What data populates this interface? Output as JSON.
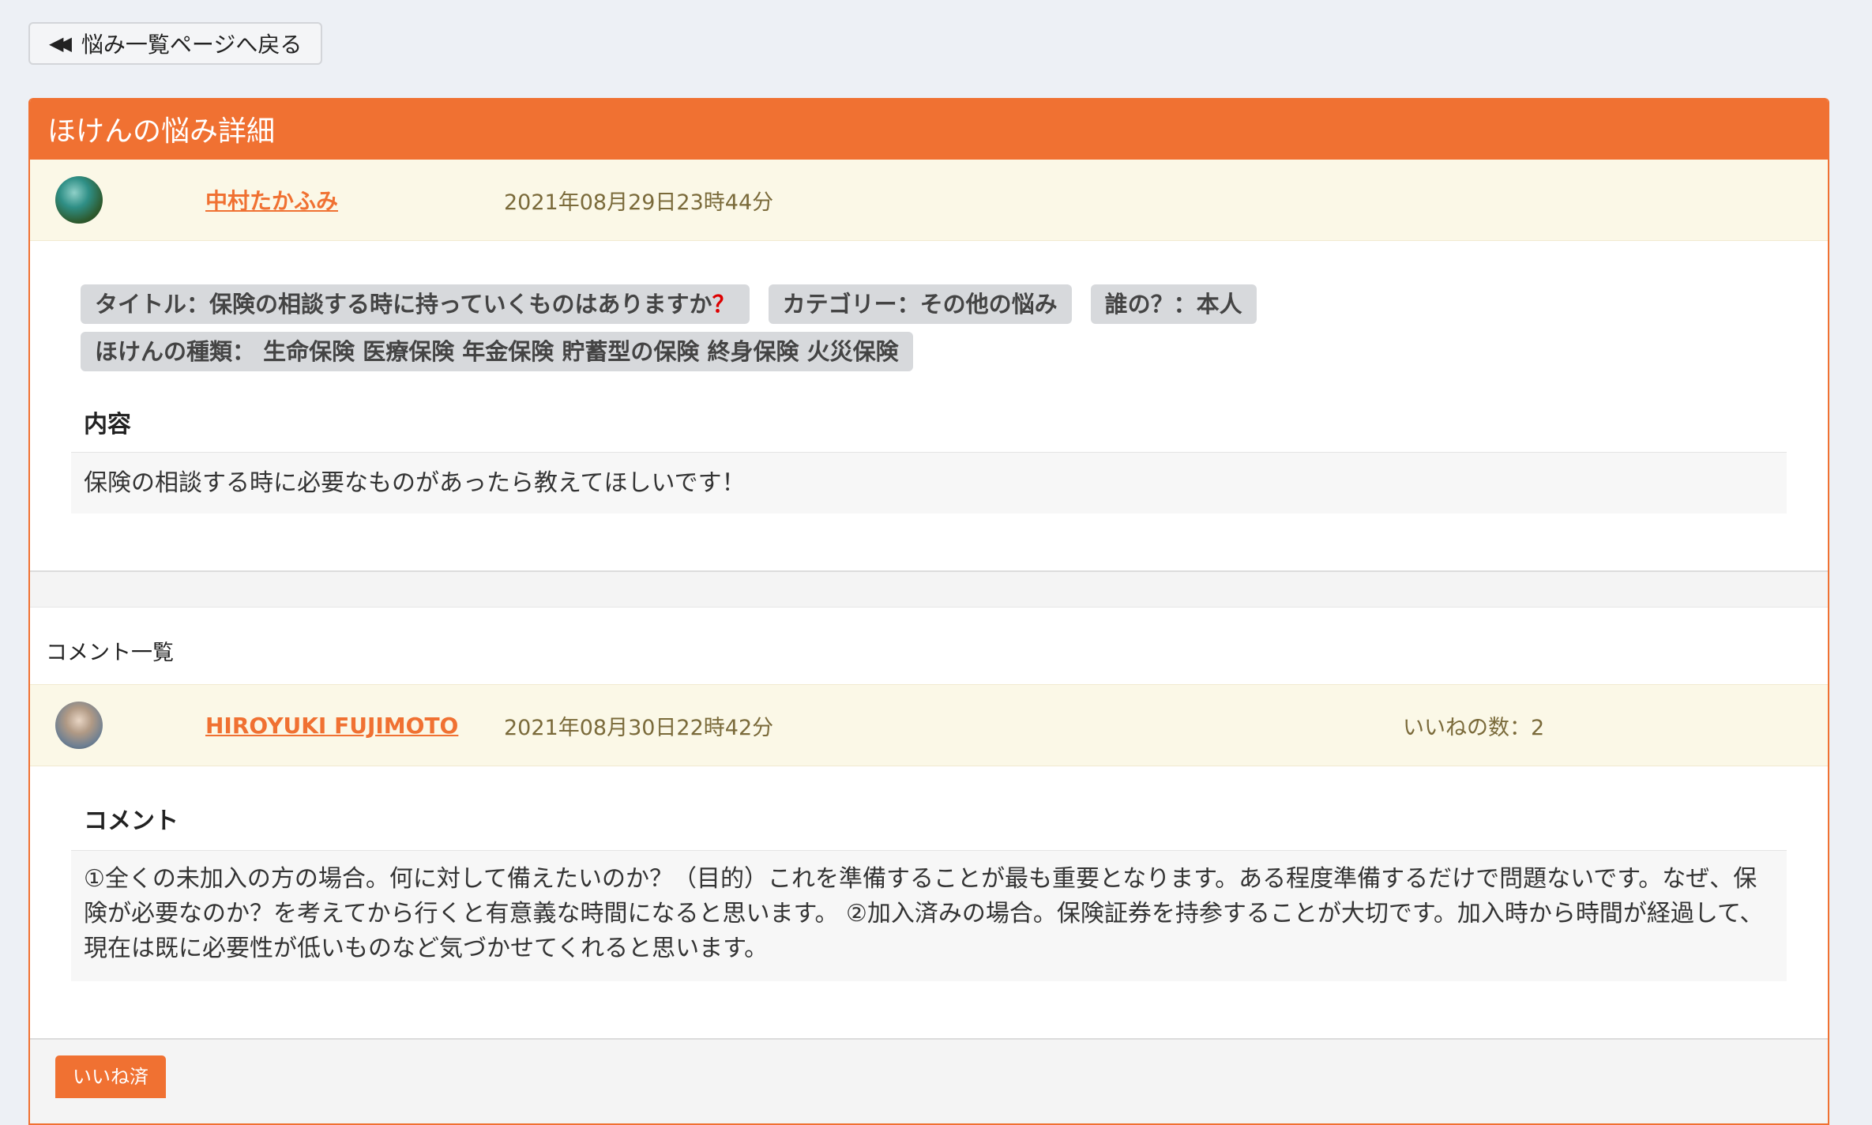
{
  "back_button": {
    "label": "悩み一覧ページへ戻る",
    "icon": "double-left-arrow-icon"
  },
  "panel": {
    "title": "ほけんの悩み詳細"
  },
  "post": {
    "author": "中村たかふみ",
    "date": "2021年08月29日23時44分",
    "tags": {
      "title": "タイトル：保険の相談する時に持っていくものはありますか",
      "title_mark": "？",
      "category": "カテゴリー：その他の悩み",
      "whose": "誰の？：本人",
      "types": "ほけんの種類： 生命保険 医療保険 年金保険 貯蓄型の保険 終身保険 火災保険"
    },
    "content_heading": "内容",
    "content": "保険の相談する時に必要なものがあったら教えてほしいです！"
  },
  "comments": {
    "list_label": "コメント一覧",
    "items": [
      {
        "author": "HIROYUKI FUJIMOTO",
        "date": "2021年08月30日22時42分",
        "likes": "いいねの数：2",
        "heading": "コメント",
        "body": "①全くの未加入の方の場合。何に対して備えたいのか？（目的）これを準備することが最も重要となります。ある程度準備するだけで問題ないです。なぜ、保険が必要なのか？を考えてから行くと有意義な時間になると思います。 ②加入済みの場合。保険証券を持参することが大切です。加入時から時間が経過して、現在は既に必要性が低いものなど気づかせてくれると思います。",
        "like_button": "いいね済"
      }
    ]
  },
  "colors": {
    "accent": "#f07132",
    "header_bg": "#fbf8e7",
    "page_bg": "#edf0f5"
  }
}
